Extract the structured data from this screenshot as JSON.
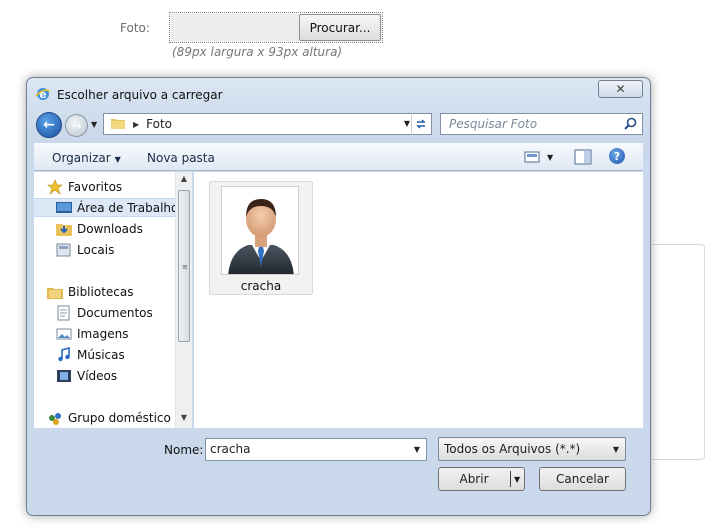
{
  "form": {
    "photo_label": "Foto:",
    "browse_label": "Procurar...",
    "hint": "(89px largura x 93px altura)"
  },
  "dialog": {
    "title": "Escolher arquivo a carregar",
    "close_glyph": "✕",
    "address": {
      "path": "Foto"
    },
    "search": {
      "placeholder": "Pesquisar Foto"
    },
    "toolbar": {
      "organize": "Organizar",
      "new_folder": "Nova pasta",
      "help": "?"
    },
    "nav": {
      "favorites": "Favoritos",
      "desktop": "Área de Trabalho",
      "downloads": "Downloads",
      "places": "Locais",
      "libraries": "Bibliotecas",
      "documents": "Documentos",
      "images": "Imagens",
      "music": "Músicas",
      "videos": "Vídeos",
      "homegroup": "Grupo doméstico"
    },
    "files": [
      {
        "name": "cracha",
        "icon": "person-avatar-icon"
      }
    ],
    "filename_label": "Nome:",
    "filename_value": "cracha",
    "filetype": "Todos os Arquivos (*.*)",
    "open_label": "Abrir",
    "cancel_label": "Cancelar"
  },
  "colors": {
    "accent": "#1d56a8",
    "selection": "#dde8f6",
    "chrome": "#c9d8ea"
  }
}
